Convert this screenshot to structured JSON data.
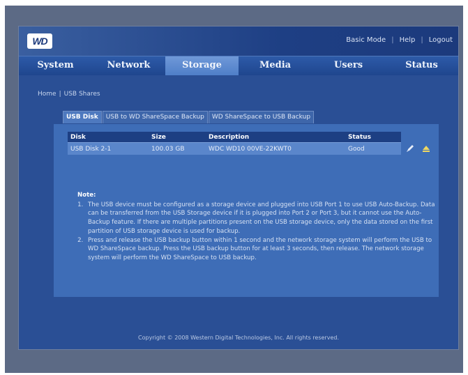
{
  "header": {
    "logo_text": "WD",
    "links": [
      "Basic Mode",
      "Help",
      "Logout"
    ]
  },
  "nav": {
    "tabs": [
      "System",
      "Network",
      "Storage",
      "Media",
      "Users",
      "Status"
    ],
    "active": "Storage"
  },
  "breadcrumb": [
    "Home",
    "USB Shares"
  ],
  "subtabs": [
    "USB Disk",
    "USB to WD ShareSpace Backup",
    "WD ShareSpace to USB Backup"
  ],
  "table": {
    "headers": [
      "Disk",
      "Size",
      "Description",
      "Status"
    ],
    "rows": [
      [
        "USB Disk 2-1",
        "100.03 GB",
        "WDC WD10 00VE-22KWT0",
        "Good"
      ]
    ]
  },
  "actions": {
    "edit_icon": "pencil-icon",
    "eject_icon": "eject-icon"
  },
  "note": {
    "title": "Note:",
    "items": [
      "The USB device must be configured as a storage device and plugged into USB Port 1 to use USB Auto-Backup. Data can be transferred from the USB Storage device if it is plugged into Port 2 or Port 3, but it cannot use the Auto-Backup feature. If there are multiple partitions present on the USB storage device, only the data stored on the first partition of USB storage device is used for backup.",
      "Press and release the USB backup button within 1 second and the network storage system will perform the USB to WD ShareSpace backup. Press the USB backup button for at least 3 seconds, then release. The network storage system will perform the WD ShareSpace to USB backup."
    ]
  },
  "footer": "Copyright © 2008 Western Digital Technologies, Inc. All rights reserved.",
  "colors": {
    "background": "#2a4f95",
    "panel": "#3e6db7",
    "table_header": "#1d3f83",
    "active_tab": "#5e8bd0"
  }
}
